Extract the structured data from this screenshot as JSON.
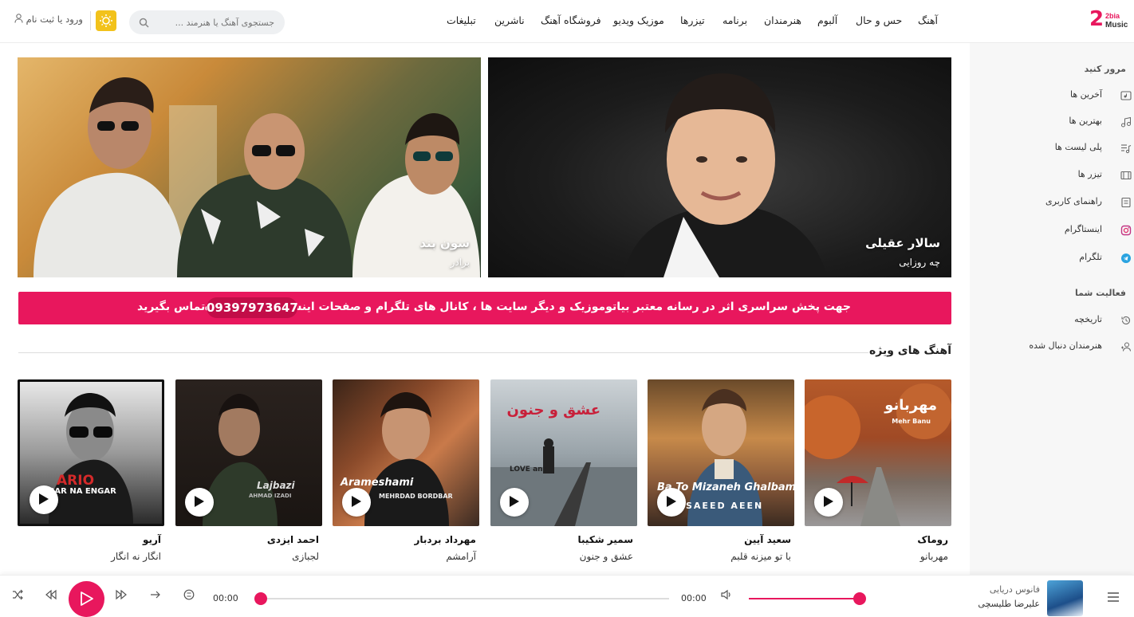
{
  "brand": {
    "logo_text": "2bia",
    "logo_sub": "Music"
  },
  "nav": {
    "items": [
      "آهنگ",
      "حس و حال",
      "آلبوم",
      "هنرمندان",
      "برنامه",
      "تیزرها",
      "موزیک ویدیو",
      "فروشگاه آهنگ",
      "ناشرین",
      "تبلیغات"
    ]
  },
  "search": {
    "placeholder": "جستجوی آهنگ یا هنرمند ..."
  },
  "header": {
    "login": "ورود یا ثبت نام"
  },
  "sidebar": {
    "browse_heading": "مرور کنید",
    "browse": [
      {
        "label": "آخرین ها",
        "icon": "music-card-icon"
      },
      {
        "label": "بهترین ها",
        "icon": "music-notes-icon"
      },
      {
        "label": "پلی لیست ها",
        "icon": "playlist-icon"
      },
      {
        "label": "تیزر ها",
        "icon": "film-icon"
      },
      {
        "label": "راهنمای کاربری",
        "icon": "book-icon"
      },
      {
        "label": "اینستاگرام",
        "icon": "instagram-icon"
      },
      {
        "label": "تلگرام",
        "icon": "telegram-icon"
      }
    ],
    "activity_heading": "فعالیت شما",
    "activity": [
      {
        "label": "تاریخچه",
        "icon": "history-icon"
      },
      {
        "label": "هنرمندان دنبال شده",
        "icon": "user-follow-icon"
      }
    ]
  },
  "banners": [
    {
      "artist": "سالار عقیلی",
      "song": "چه روزایی"
    },
    {
      "artist": "سون بند",
      "song": "برادر"
    }
  ],
  "promo": {
    "message": "جهت پخش سراسری اثر در رسانه معتبر بیاتوموزیک و دیگر سایت ها ، کانال های تلگرام و صفحات اینستاگرام با شماره",
    "phone": "09397973647",
    "cta": "تماس بگیرید"
  },
  "featured": {
    "heading": "آهنگ های ویژه",
    "cards": [
      {
        "artist": "روماک",
        "song": "مهربانو",
        "cover_text": "مهربانو",
        "cover_sub": "Mehr Banu"
      },
      {
        "artist": "سعید آیین",
        "song": "با تو میزنه قلبم",
        "cover_text": "Ba To Mizaneh Ghalbam",
        "cover_sub": "SAEED AEEN"
      },
      {
        "artist": "سمیر شکیبا",
        "song": "عشق و جنون",
        "cover_text": "عشق و جنون",
        "cover_sub": "LOVE and"
      },
      {
        "artist": "مهرداد بردبار",
        "song": "آرامشم",
        "cover_text": "Arameshami",
        "cover_sub": "MEHRDAD BORDBAR"
      },
      {
        "artist": "احمد ایزدی",
        "song": "لجبازی",
        "cover_text": "Lajbazi",
        "cover_sub": "AHMAD IZADI"
      },
      {
        "artist": "آریو",
        "song": "انگار نه انگار",
        "cover_text": "ARIO",
        "cover_sub": "ENGAR NA ENGAR"
      }
    ]
  },
  "player": {
    "title": "فانوس دریایی",
    "artist": "علیرضا طلیسچی",
    "elapsed": "00:00",
    "duration": "00:00",
    "progress": 0,
    "volume": 1
  },
  "colors": {
    "accent": "#e8175d",
    "sun": "#f2c21b"
  }
}
